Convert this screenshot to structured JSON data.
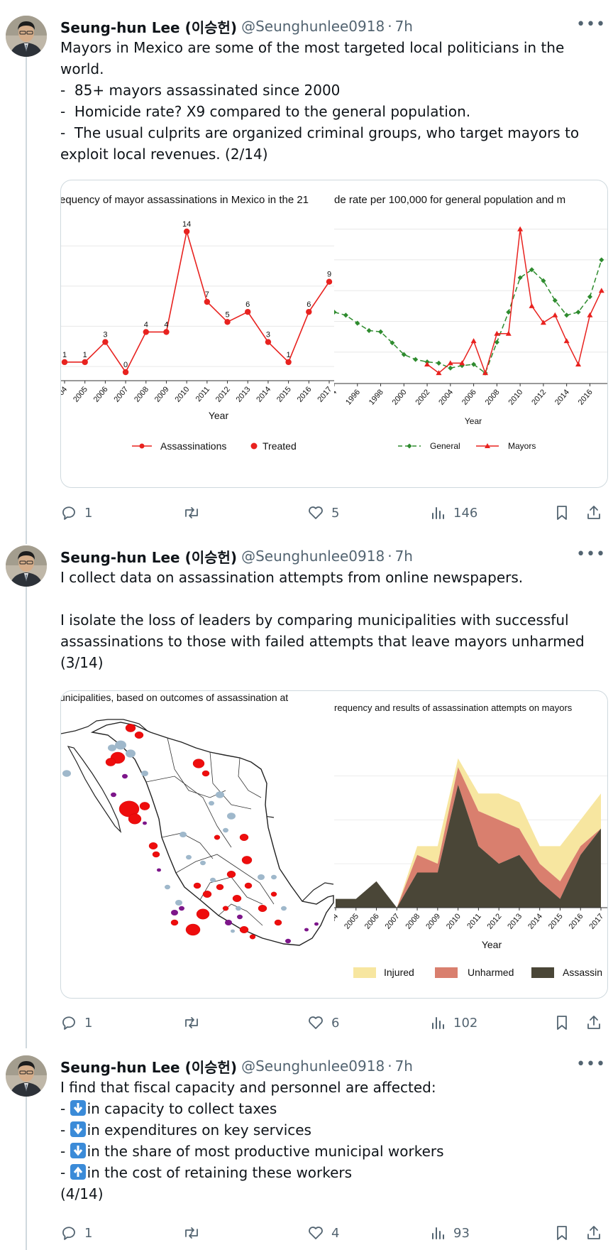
{
  "tweets": [
    {
      "name": "Seung-hun Lee (이승헌)",
      "handle": "@Seunghunlee0918",
      "time": "7h",
      "lines": [
        "Mayors in Mexico are some of the most targeted local politicians in the",
        "world.",
        "-  85+ mayors assassinated since 2000",
        "-  Homicide rate? X9 compared to the general population.",
        "-  The usual culprits are organized criminal groups, who target mayors to",
        "exploit local revenues. (2/14)"
      ],
      "replies": "1",
      "likes": "5",
      "views": "146"
    },
    {
      "name": "Seung-hun Lee (이승헌)",
      "handle": "@Seunghunlee0918",
      "time": "7h",
      "lines": [
        "I collect data on assassination attempts from online newspapers.",
        "",
        "I isolate the loss of leaders by comparing municipalities with successful",
        "assassinations to those with failed attempts that leave mayors unharmed",
        "(3/14)"
      ],
      "replies": "1",
      "likes": "6",
      "views": "102"
    },
    {
      "name": "Seung-hun Lee (이승헌)",
      "handle": "@Seunghunlee0918",
      "time": "7h",
      "lines": [
        "I find that fiscal capacity and personnel are affected:"
      ],
      "bullets": [
        {
          "prefix": "- ",
          "arrow": "down",
          "text": "in capacity to collect taxes"
        },
        {
          "prefix": "- ",
          "arrow": "down",
          "text": "in expenditures on key services"
        },
        {
          "prefix": "- ",
          "arrow": "down",
          "text": "in the share of most productive municipal workers"
        },
        {
          "prefix": "- ",
          "arrow": "up",
          "text": "in the cost of retaining these workers"
        }
      ],
      "tail": "(4/14)",
      "replies": "1",
      "likes": "4",
      "views": "93"
    }
  ],
  "chart_data": [
    {
      "type": "line",
      "title": "equency of mayor assassinations in Mexico in the 21",
      "xlabel": "Year",
      "x": [
        2004,
        2005,
        2006,
        2007,
        2008,
        2009,
        2010,
        2011,
        2012,
        2013,
        2014,
        2015,
        2016,
        2017
      ],
      "x_tick_labels": [
        "04",
        "2005",
        "2006",
        "2007",
        "2008",
        "2009",
        "2010",
        "2011",
        "2012",
        "2013",
        "2014",
        "2015",
        "2016",
        "2017"
      ],
      "series": [
        {
          "name": "Assassinations",
          "values": [
            1,
            1,
            3,
            0,
            4,
            4,
            14,
            7,
            5,
            6,
            3,
            1,
            6,
            9
          ],
          "color": "#e8221f"
        }
      ],
      "legend": [
        "Assassinations",
        "Treated"
      ],
      "legend_position": "bottom",
      "ylim": [
        0,
        14
      ],
      "grid": true
    },
    {
      "type": "line",
      "title": "de rate per 100,000 for general population and m",
      "xlabel": "Year",
      "x_tick_labels": [
        "94",
        "1996",
        "1998",
        "2000",
        "2002",
        "2004",
        "2006",
        "2008",
        "2010",
        "2012",
        "2014",
        "2016"
      ],
      "series": [
        {
          "name": "General",
          "x": [
            1994,
            1995,
            1996,
            1997,
            1998,
            1999,
            2000,
            2001,
            2002,
            2003,
            2004,
            2005,
            2006,
            2007,
            2008,
            2009,
            2010,
            2011,
            2012,
            2013,
            2014,
            2015,
            2016,
            2017
          ],
          "values": [
            16.5,
            16.0,
            14.7,
            13.5,
            13.3,
            11.5,
            9.6,
            8.8,
            8.4,
            8.2,
            7.4,
            7.8,
            8.0,
            6.6,
            11.6,
            16.5,
            22.1,
            23.4,
            21.6,
            18.4,
            16.0,
            16.5,
            19.0,
            25.0
          ],
          "style": "dashed",
          "color": "#2e8b2e"
        },
        {
          "name": "Mayors",
          "x": [
            2002,
            2003,
            2004,
            2005,
            2006,
            2007,
            2008,
            2009,
            2010,
            2011,
            2012,
            2013,
            2014,
            2015,
            2016,
            2017
          ],
          "values": [
            8.0,
            6.6,
            8.2,
            8.2,
            11.8,
            6.6,
            13.0,
            13.0,
            30.0,
            17.5,
            14.8,
            16.0,
            11.8,
            8.0,
            16.0,
            20.0
          ],
          "color": "#e8221f"
        }
      ],
      "legend": [
        "General",
        "Mayors"
      ],
      "legend_position": "bottom",
      "ylim": [
        5,
        31
      ],
      "grid": true
    },
    {
      "type": "area",
      "title": "requency and results of assassination attempts on mayors",
      "xlabel": "Year",
      "categories": [
        "04",
        "2005",
        "2006",
        "2007",
        "2008",
        "2009",
        "2010",
        "2011",
        "2012",
        "2013",
        "2014",
        "2015",
        "2016",
        "2017"
      ],
      "series": [
        {
          "name": "Assassin",
          "values": [
            1,
            1,
            3,
            0,
            4,
            4,
            14,
            7,
            5,
            6,
            3,
            1,
            6,
            9
          ],
          "color": "#4a4637"
        },
        {
          "name": "Unharmed",
          "values": [
            0,
            0,
            0,
            0,
            2,
            1,
            2,
            4,
            5,
            3,
            2,
            2,
            1,
            0
          ],
          "color": "#d97f6e"
        },
        {
          "name": "Injured",
          "values": [
            0,
            0,
            0,
            0,
            1,
            2,
            1,
            2,
            3,
            3,
            2,
            4,
            3,
            4
          ],
          "color": "#f7e6a0"
        }
      ],
      "legend_position": "bottom",
      "ylim": [
        0,
        19
      ],
      "grid": true
    }
  ],
  "map_panel": {
    "title": "unicipalities, based on outcomes of assassination at",
    "colors": {
      "red": "#ee0d0d",
      "blue": "#9fb8cb",
      "purple": "#7d168a"
    }
  }
}
